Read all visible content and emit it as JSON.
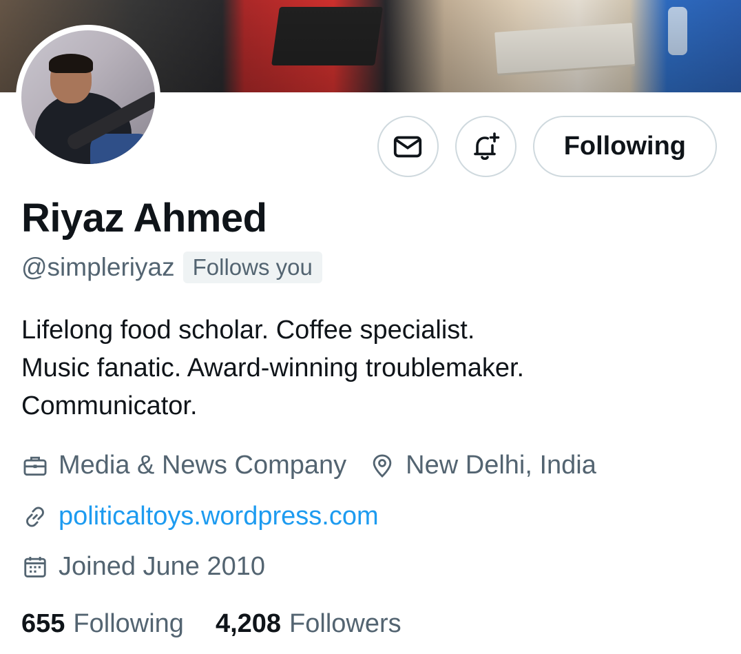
{
  "profile": {
    "name": "Riyaz Ahmed",
    "handle": "@simpleriyaz",
    "follows_you": "Follows you",
    "bio": [
      "Lifelong food scholar. Coffee specialist.",
      "Music fanatic. Award-winning troublemaker.",
      "Communicator."
    ],
    "category": "Media & News Company",
    "location": "New Delhi, India",
    "website": "politicaltoys.wordpress.com",
    "joined": "Joined June 2010"
  },
  "actions": {
    "message_icon": "envelope-icon",
    "notify_icon": "bell-plus-icon",
    "follow_label": "Following"
  },
  "stats": {
    "following_count": "655",
    "following_label": "Following",
    "followers_count": "4,208",
    "followers_label": "Followers"
  },
  "colors": {
    "text": "#0f1419",
    "secondary": "#536471",
    "link": "#1d9bf0",
    "border": "#cfd9de"
  }
}
